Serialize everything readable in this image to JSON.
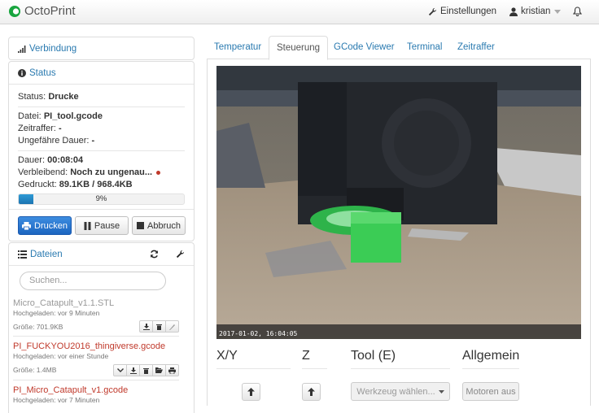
{
  "app": {
    "title": "OctoPrint"
  },
  "nav": {
    "settings": "Einstellungen",
    "user": "kristian"
  },
  "connection": {
    "title": "Verbindung"
  },
  "status": {
    "title": "Status",
    "state_label": "Status:",
    "state_value": "Drucke",
    "file_label": "Datei:",
    "file_value": "PI_tool.gcode",
    "timelapse_label": "Zeitraffer:",
    "timelapse_value": "-",
    "approx_label": "Ungefähre Dauer:",
    "approx_value": "-",
    "duration_label": "Dauer:",
    "duration_value": "00:08:04",
    "remaining_label": "Verbleibend:",
    "remaining_value": "Noch zu ungenau...",
    "printed_label": "Gedruckt:",
    "printed_value": "89.1KB / 968.4KB",
    "progress_text": "9%",
    "progress_value": 0.09
  },
  "controls": {
    "print": "Drucken",
    "pause": "Pause",
    "cancel": "Abbruch"
  },
  "files": {
    "title": "Dateien",
    "search_placeholder": "Suchen...",
    "items": [
      {
        "name": "Micro_Catapult_v1.1.STL",
        "uploaded": "Hochgeladen: vor 9 Minuten",
        "size": "Größe: 701.9KB"
      },
      {
        "name": "PI_FUCKYOU2016_thingiverse.gcode",
        "uploaded": "Hochgeladen: vor einer Stunde",
        "size": "Größe: 1.4MB"
      },
      {
        "name": "PI_Micro_Catapult_v1.gcode",
        "uploaded": "Hochgeladen: vor 7 Minuten"
      }
    ]
  },
  "tabs": [
    "Temperatur",
    "Steuerung",
    "GCode Viewer",
    "Terminal",
    "Zeitraffer"
  ],
  "webcam": {
    "timestamp": "2017-01-02, 16:04:05"
  },
  "sections": {
    "xy": "X/Y",
    "z": "Z",
    "tool": "Tool (E)",
    "general": "Allgemein"
  },
  "tool_select": "Werkzeug wählen...",
  "motors_off": "Motoren aus",
  "colors": {
    "link": "#2a7ab0",
    "primary": "#2c7dd6",
    "file_red": "#c0392b",
    "file_grey": "#999999"
  }
}
